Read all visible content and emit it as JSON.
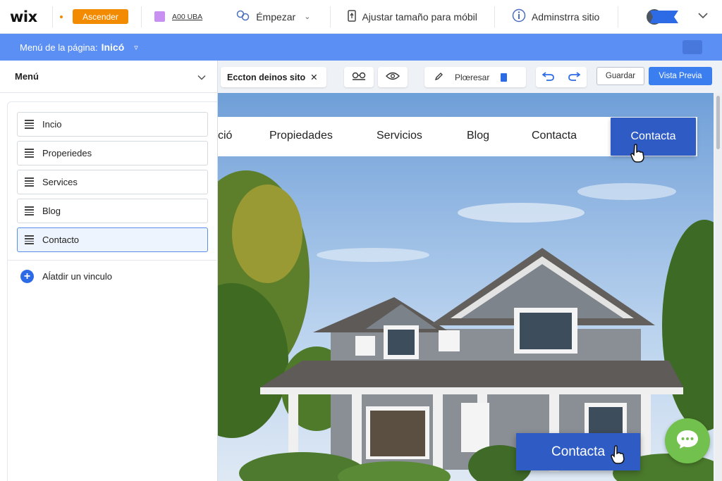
{
  "app": {
    "logo": "wix",
    "upgrade_label": "Ascender",
    "add_domain_label": "A00 UBA",
    "start_label": "Émpezar",
    "mobile_label": "Ajustar tamaño para móbil",
    "manage_label": "Adminstrra sitio",
    "help_label": "?"
  },
  "pagebar": {
    "prefix": "Menú de la página:",
    "page": "Inicó"
  },
  "panel": {
    "title": "Menú",
    "items": [
      {
        "label": "Incio"
      },
      {
        "label": "Properiedes"
      },
      {
        "label": "Services"
      },
      {
        "label": "Blog"
      },
      {
        "label": "Contacto"
      }
    ],
    "add_link_label": "Aĺatdir un vinculo"
  },
  "toolbar": {
    "section_label": "Eccton deinos sito",
    "edit_label": "Plœresar",
    "save_label": "Guardar",
    "preview_label": "Vista Previa"
  },
  "site": {
    "nav": [
      "ció",
      "Propiedades",
      "Servicios",
      "Blog",
      "Contacta"
    ],
    "nav_cta": "Contacta",
    "hero_cta": "Contacta"
  },
  "colors": {
    "accent": "#2d6be6",
    "upgrade": "#f38b00",
    "pagebar": "#5b8ff3",
    "cta": "#2e5cc4",
    "chat": "#72c04e"
  }
}
